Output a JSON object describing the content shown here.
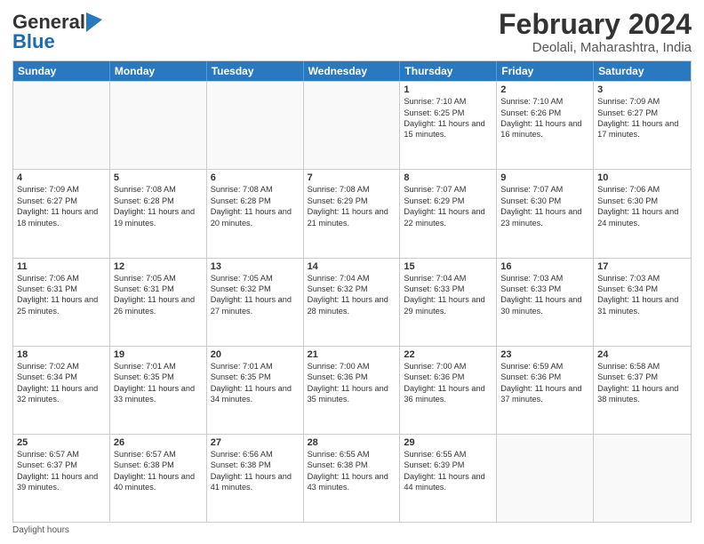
{
  "logo": {
    "general": "General",
    "blue": "Blue"
  },
  "title": "February 2024",
  "subtitle": "Deolali, Maharashtra, India",
  "days_of_week": [
    "Sunday",
    "Monday",
    "Tuesday",
    "Wednesday",
    "Thursday",
    "Friday",
    "Saturday"
  ],
  "weeks": [
    [
      {
        "day": "",
        "sunrise": "",
        "sunset": "",
        "daylight": "",
        "empty": true
      },
      {
        "day": "",
        "sunrise": "",
        "sunset": "",
        "daylight": "",
        "empty": true
      },
      {
        "day": "",
        "sunrise": "",
        "sunset": "",
        "daylight": "",
        "empty": true
      },
      {
        "day": "",
        "sunrise": "",
        "sunset": "",
        "daylight": "",
        "empty": true
      },
      {
        "day": "1",
        "sunrise": "Sunrise: 7:10 AM",
        "sunset": "Sunset: 6:25 PM",
        "daylight": "Daylight: 11 hours and 15 minutes.",
        "empty": false
      },
      {
        "day": "2",
        "sunrise": "Sunrise: 7:10 AM",
        "sunset": "Sunset: 6:26 PM",
        "daylight": "Daylight: 11 hours and 16 minutes.",
        "empty": false
      },
      {
        "day": "3",
        "sunrise": "Sunrise: 7:09 AM",
        "sunset": "Sunset: 6:27 PM",
        "daylight": "Daylight: 11 hours and 17 minutes.",
        "empty": false
      }
    ],
    [
      {
        "day": "4",
        "sunrise": "Sunrise: 7:09 AM",
        "sunset": "Sunset: 6:27 PM",
        "daylight": "Daylight: 11 hours and 18 minutes.",
        "empty": false
      },
      {
        "day": "5",
        "sunrise": "Sunrise: 7:08 AM",
        "sunset": "Sunset: 6:28 PM",
        "daylight": "Daylight: 11 hours and 19 minutes.",
        "empty": false
      },
      {
        "day": "6",
        "sunrise": "Sunrise: 7:08 AM",
        "sunset": "Sunset: 6:28 PM",
        "daylight": "Daylight: 11 hours and 20 minutes.",
        "empty": false
      },
      {
        "day": "7",
        "sunrise": "Sunrise: 7:08 AM",
        "sunset": "Sunset: 6:29 PM",
        "daylight": "Daylight: 11 hours and 21 minutes.",
        "empty": false
      },
      {
        "day": "8",
        "sunrise": "Sunrise: 7:07 AM",
        "sunset": "Sunset: 6:29 PM",
        "daylight": "Daylight: 11 hours and 22 minutes.",
        "empty": false
      },
      {
        "day": "9",
        "sunrise": "Sunrise: 7:07 AM",
        "sunset": "Sunset: 6:30 PM",
        "daylight": "Daylight: 11 hours and 23 minutes.",
        "empty": false
      },
      {
        "day": "10",
        "sunrise": "Sunrise: 7:06 AM",
        "sunset": "Sunset: 6:30 PM",
        "daylight": "Daylight: 11 hours and 24 minutes.",
        "empty": false
      }
    ],
    [
      {
        "day": "11",
        "sunrise": "Sunrise: 7:06 AM",
        "sunset": "Sunset: 6:31 PM",
        "daylight": "Daylight: 11 hours and 25 minutes.",
        "empty": false
      },
      {
        "day": "12",
        "sunrise": "Sunrise: 7:05 AM",
        "sunset": "Sunset: 6:31 PM",
        "daylight": "Daylight: 11 hours and 26 minutes.",
        "empty": false
      },
      {
        "day": "13",
        "sunrise": "Sunrise: 7:05 AM",
        "sunset": "Sunset: 6:32 PM",
        "daylight": "Daylight: 11 hours and 27 minutes.",
        "empty": false
      },
      {
        "day": "14",
        "sunrise": "Sunrise: 7:04 AM",
        "sunset": "Sunset: 6:32 PM",
        "daylight": "Daylight: 11 hours and 28 minutes.",
        "empty": false
      },
      {
        "day": "15",
        "sunrise": "Sunrise: 7:04 AM",
        "sunset": "Sunset: 6:33 PM",
        "daylight": "Daylight: 11 hours and 29 minutes.",
        "empty": false
      },
      {
        "day": "16",
        "sunrise": "Sunrise: 7:03 AM",
        "sunset": "Sunset: 6:33 PM",
        "daylight": "Daylight: 11 hours and 30 minutes.",
        "empty": false
      },
      {
        "day": "17",
        "sunrise": "Sunrise: 7:03 AM",
        "sunset": "Sunset: 6:34 PM",
        "daylight": "Daylight: 11 hours and 31 minutes.",
        "empty": false
      }
    ],
    [
      {
        "day": "18",
        "sunrise": "Sunrise: 7:02 AM",
        "sunset": "Sunset: 6:34 PM",
        "daylight": "Daylight: 11 hours and 32 minutes.",
        "empty": false
      },
      {
        "day": "19",
        "sunrise": "Sunrise: 7:01 AM",
        "sunset": "Sunset: 6:35 PM",
        "daylight": "Daylight: 11 hours and 33 minutes.",
        "empty": false
      },
      {
        "day": "20",
        "sunrise": "Sunrise: 7:01 AM",
        "sunset": "Sunset: 6:35 PM",
        "daylight": "Daylight: 11 hours and 34 minutes.",
        "empty": false
      },
      {
        "day": "21",
        "sunrise": "Sunrise: 7:00 AM",
        "sunset": "Sunset: 6:36 PM",
        "daylight": "Daylight: 11 hours and 35 minutes.",
        "empty": false
      },
      {
        "day": "22",
        "sunrise": "Sunrise: 7:00 AM",
        "sunset": "Sunset: 6:36 PM",
        "daylight": "Daylight: 11 hours and 36 minutes.",
        "empty": false
      },
      {
        "day": "23",
        "sunrise": "Sunrise: 6:59 AM",
        "sunset": "Sunset: 6:36 PM",
        "daylight": "Daylight: 11 hours and 37 minutes.",
        "empty": false
      },
      {
        "day": "24",
        "sunrise": "Sunrise: 6:58 AM",
        "sunset": "Sunset: 6:37 PM",
        "daylight": "Daylight: 11 hours and 38 minutes.",
        "empty": false
      }
    ],
    [
      {
        "day": "25",
        "sunrise": "Sunrise: 6:57 AM",
        "sunset": "Sunset: 6:37 PM",
        "daylight": "Daylight: 11 hours and 39 minutes.",
        "empty": false
      },
      {
        "day": "26",
        "sunrise": "Sunrise: 6:57 AM",
        "sunset": "Sunset: 6:38 PM",
        "daylight": "Daylight: 11 hours and 40 minutes.",
        "empty": false
      },
      {
        "day": "27",
        "sunrise": "Sunrise: 6:56 AM",
        "sunset": "Sunset: 6:38 PM",
        "daylight": "Daylight: 11 hours and 41 minutes.",
        "empty": false
      },
      {
        "day": "28",
        "sunrise": "Sunrise: 6:55 AM",
        "sunset": "Sunset: 6:38 PM",
        "daylight": "Daylight: 11 hours and 43 minutes.",
        "empty": false
      },
      {
        "day": "29",
        "sunrise": "Sunrise: 6:55 AM",
        "sunset": "Sunset: 6:39 PM",
        "daylight": "Daylight: 11 hours and 44 minutes.",
        "empty": false
      },
      {
        "day": "",
        "sunrise": "",
        "sunset": "",
        "daylight": "",
        "empty": true
      },
      {
        "day": "",
        "sunrise": "",
        "sunset": "",
        "daylight": "",
        "empty": true
      }
    ]
  ],
  "footer": "Daylight hours"
}
